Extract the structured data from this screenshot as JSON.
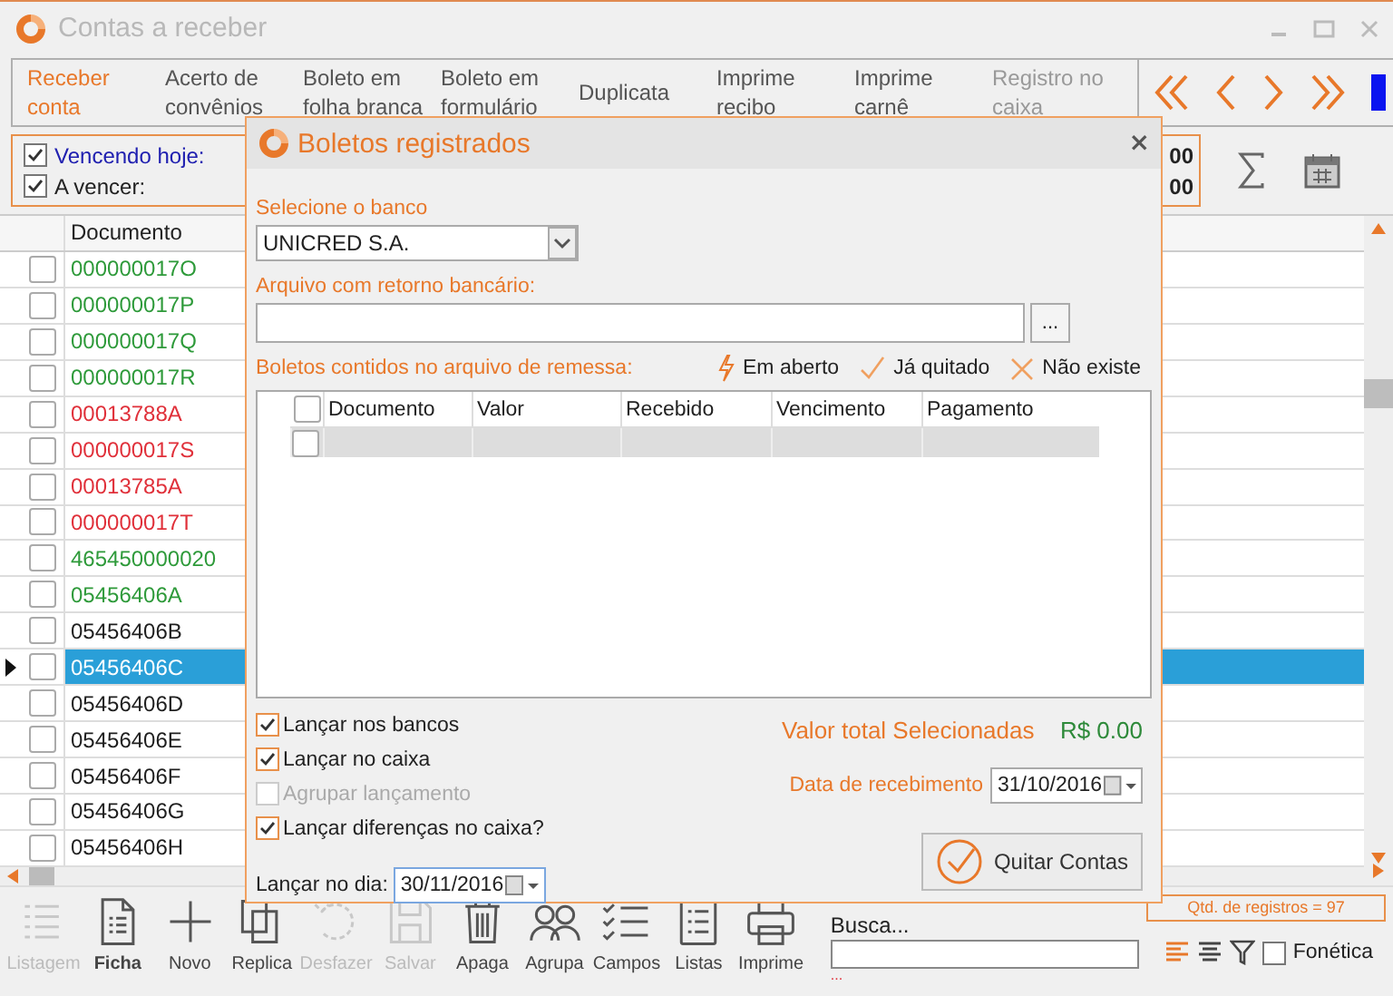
{
  "window": {
    "title": "Contas a receber"
  },
  "tabs": [
    {
      "label": "Receber conta",
      "selected": true,
      "disabled": false
    },
    {
      "label": "Acerto de convênios",
      "selected": false,
      "disabled": false
    },
    {
      "label": "Boleto em folha branca",
      "selected": false,
      "disabled": false
    },
    {
      "label": "Boleto em formulário",
      "selected": false,
      "disabled": false
    },
    {
      "label": "Duplicata",
      "selected": false,
      "disabled": false
    },
    {
      "label": "Imprime recibo",
      "selected": false,
      "disabled": false
    },
    {
      "label": "Imprime carnê",
      "selected": false,
      "disabled": false
    },
    {
      "label": "Registro no caixa",
      "selected": false,
      "disabled": true
    }
  ],
  "filters": [
    {
      "label": "Vencendo hoje:",
      "checked": true,
      "highlighted": true,
      "value": "00"
    },
    {
      "label": "A vencer:",
      "checked": true,
      "highlighted": false,
      "value": "00"
    }
  ],
  "grid": {
    "columns": [
      "Documento"
    ],
    "rows": [
      {
        "documento": "000000017O",
        "color": "#2e9a3a",
        "checked": false,
        "selected": false
      },
      {
        "documento": "000000017P",
        "color": "#2e9a3a",
        "checked": false,
        "selected": false
      },
      {
        "documento": "000000017Q",
        "color": "#2e9a3a",
        "checked": false,
        "selected": false
      },
      {
        "documento": "000000017R",
        "color": "#2e9a3a",
        "checked": false,
        "selected": false
      },
      {
        "documento": "00013788A",
        "color": "#e0303a",
        "checked": false,
        "selected": false
      },
      {
        "documento": "000000017S",
        "color": "#e0303a",
        "checked": false,
        "selected": false
      },
      {
        "documento": "00013785A",
        "color": "#e0303a",
        "checked": false,
        "selected": false
      },
      {
        "documento": "000000017T",
        "color": "#e0303a",
        "checked": false,
        "selected": false
      },
      {
        "documento": "465450000020",
        "color": "#2e9a3a",
        "checked": false,
        "selected": false
      },
      {
        "documento": "05456406A",
        "color": "#2e9a3a",
        "checked": false,
        "selected": false
      },
      {
        "documento": "05456406B",
        "color": "#1e1e1e",
        "checked": false,
        "selected": false
      },
      {
        "documento": "05456406C",
        "checked": false,
        "selected": true
      },
      {
        "documento": "05456406D",
        "color": "#1e1e1e",
        "checked": false,
        "selected": false
      },
      {
        "documento": "05456406E",
        "color": "#1e1e1e",
        "checked": false,
        "selected": false
      },
      {
        "documento": "05456406F",
        "color": "#1e1e1e",
        "checked": false,
        "selected": false
      },
      {
        "documento": "05456406G",
        "color": "#1e1e1e",
        "checked": false,
        "selected": false
      },
      {
        "documento": "05456406H",
        "color": "#1e1e1e",
        "checked": false,
        "selected": false
      }
    ]
  },
  "record_count": "Qtd. de registros = 97",
  "toolbar": [
    {
      "kind": "list",
      "label": "Listagem",
      "disabled": true,
      "selected": false
    },
    {
      "kind": "form",
      "label": "Ficha",
      "disabled": false,
      "selected": true
    },
    {
      "kind": "plus",
      "label": "Novo",
      "disabled": false,
      "selected": false
    },
    {
      "kind": "copy",
      "label": "Replica",
      "disabled": false,
      "selected": false
    },
    {
      "kind": "undo",
      "label": "Desfazer",
      "disabled": true,
      "selected": false
    },
    {
      "kind": "save",
      "label": "Salvar",
      "disabled": true,
      "selected": false
    },
    {
      "kind": "trash",
      "label": "Apaga",
      "disabled": false,
      "selected": false
    },
    {
      "kind": "group",
      "label": "Agrupa",
      "disabled": false,
      "selected": false
    },
    {
      "kind": "fields",
      "label": "Campos",
      "disabled": false,
      "selected": false
    },
    {
      "kind": "lists",
      "label": "Listas",
      "disabled": false,
      "selected": false
    },
    {
      "kind": "print",
      "label": "Imprime",
      "disabled": false,
      "selected": false
    }
  ],
  "search": {
    "label": "Busca...",
    "hint": "..."
  },
  "search_options": [
    {
      "kind": "align-left",
      "selected": true
    },
    {
      "kind": "align-center",
      "selected": false
    },
    {
      "kind": "filter",
      "selected": false
    }
  ],
  "phonetic": {
    "label": "Fonética",
    "checked": false
  },
  "dialog": {
    "title": "Boletos registrados",
    "close": "×",
    "bank": {
      "label": "Selecione o banco",
      "value": "UNICRED S.A."
    },
    "file": {
      "label": "Arquivo com retorno bancário:",
      "button": "..."
    },
    "boletos": {
      "label": "Boletos contidos no arquivo de remessa:",
      "legend": [
        {
          "kind": "open",
          "label": "Em aberto"
        },
        {
          "kind": "paid",
          "label": "Já quitado"
        },
        {
          "kind": "missing",
          "label": "Não existe"
        }
      ],
      "columns": [
        "Documento",
        "Valor",
        "Recebido",
        "Vencimento",
        "Pagamento"
      ],
      "header_checked": false,
      "rows": [
        {
          "checked": false
        }
      ]
    },
    "options": [
      {
        "label": "Lançar nos bancos",
        "checked": true,
        "disabled": false
      },
      {
        "label": "Lançar no caixa",
        "checked": true,
        "disabled": false
      },
      {
        "label": "Agrupar lançamento",
        "checked": false,
        "disabled": true
      },
      {
        "label": "Lançar diferenças no caixa?",
        "checked": true,
        "disabled": false
      }
    ],
    "post_date": {
      "label": "Lançar no dia:",
      "value": "30/11/2016",
      "focused": true
    },
    "total": {
      "label": "Valor total Selecionadas",
      "value": "R$ 0.00"
    },
    "receipt_date": {
      "label": "Data de recebimento",
      "value": "31/10/2016",
      "focused": false
    },
    "confirm_button": "Quitar Contas"
  }
}
